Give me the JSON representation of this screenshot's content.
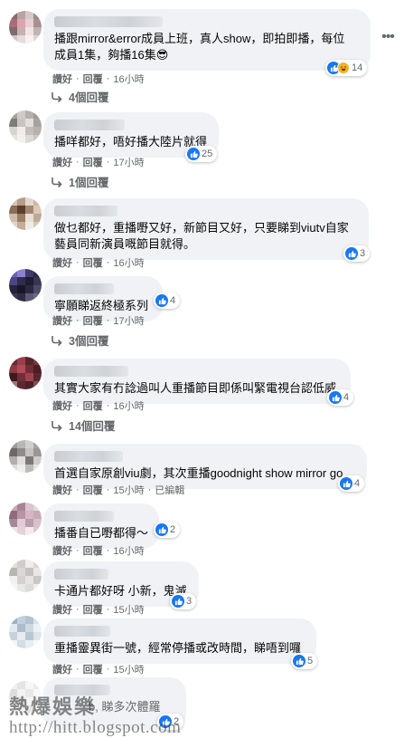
{
  "labels": {
    "like": "讚好",
    "reply": "回覆",
    "edited": "已編輯",
    "dot": "·"
  },
  "comments": [
    {
      "text": "播跟mirror&error成員上班，真人show，即拍即播，每位\n成員1集，夠播16集😎",
      "time": "16小時",
      "reactions": "14",
      "replies": "4個回覆",
      "edited": false
    },
    {
      "text": "播咩都好，唔好播大陸片就得",
      "time": "17小時",
      "reactions": "25",
      "replies": "1個回覆",
      "edited": false
    },
    {
      "text": "做乜都好，重播嘢又好，新節目又好，只要睇到viutv自家\n藝員同新演員嘅節目就得。",
      "time": "16小時",
      "reactions": "3",
      "replies": "",
      "edited": false
    },
    {
      "text": "寧願睇返終極系列",
      "time": "17小時",
      "reactions": "4",
      "replies": "3個回覆",
      "edited": false
    },
    {
      "text": "其實大家有冇諗過叫人重播節目即係叫緊電視台認低威",
      "time": "16小時",
      "reactions": "4",
      "replies": "14個回覆",
      "edited": false
    },
    {
      "text": "首選自家原創viu劇，其次重播goodnight show mirror go",
      "time": "15小時",
      "reactions": "4",
      "replies": "",
      "edited": true
    },
    {
      "text": "播番自已嘢都得～",
      "time": "16小時",
      "reactions": "2",
      "replies": "",
      "edited": false
    },
    {
      "text": "卡通片都好呀 小新，鬼滅",
      "time": "15小時",
      "reactions": "3",
      "replies": "",
      "edited": false
    },
    {
      "text": "重播靈異街一號，經常停播或改時間，睇唔到囉",
      "time": "15小時",
      "reactions": "5",
      "replies": "",
      "edited": false
    },
    {
      "text": "b, 睇多次體羅",
      "time": "",
      "reactions": "2",
      "replies": "",
      "edited": false
    }
  ],
  "watermark": {
    "line1": "熱爆娛樂",
    "line2": "http://hitt.blogspot.com"
  },
  "colors": {
    "bubble": "#f0f2f5",
    "secondary_text": "#65676b",
    "like_blue": "#1877f2",
    "haha_yellow": "#f7b125"
  },
  "icons": [
    "like-icon",
    "haha-icon",
    "reply-arrow-icon",
    "more-options-icon"
  ]
}
